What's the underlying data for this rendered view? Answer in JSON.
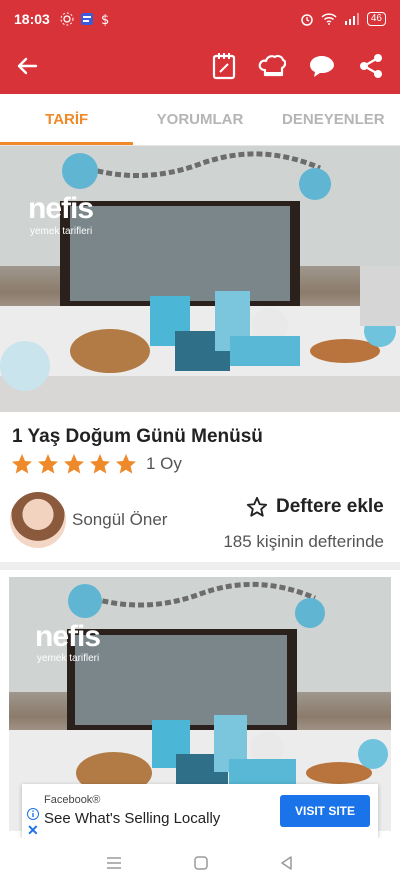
{
  "status_bar": {
    "time": "18:03",
    "battery": "46",
    "icons": [
      "activity-icon",
      "notification-app-icon",
      "dollar-icon",
      "alarm-icon",
      "wifi-icon",
      "signal-icon"
    ]
  },
  "app_bar": {
    "back_icon": "arrow-left-icon",
    "actions": [
      "notebook-icon",
      "chef-hat-icon",
      "comment-icon",
      "share-icon"
    ]
  },
  "tabs": [
    {
      "label": "TARİF",
      "active": true
    },
    {
      "label": "YORUMLAR",
      "active": false
    },
    {
      "label": "DENEYENLER",
      "active": false
    }
  ],
  "hero": {
    "wordmark": "nefis",
    "wordmark_sub": "yemek tarifleri"
  },
  "recipe": {
    "title": "1 Yaş Doğum Günü Menüsü",
    "rating_stars": 5,
    "rating_count": "1 Oy"
  },
  "author": {
    "name": "Songül Öner"
  },
  "save": {
    "label": "Deftere ekle",
    "count_text": "185 kişinin defterinde"
  },
  "second_photo": {
    "wordmark": "nefis",
    "wordmark_sub": "yemek tarifleri"
  },
  "ad": {
    "brand": "Facebook®",
    "headline": "See What's Selling Locally",
    "cta": "VISIT SITE"
  },
  "colors": {
    "primary": "#d9333a",
    "accent": "#ef8a2a",
    "star": "#ef8a2a",
    "ad_button": "#1a73e8"
  }
}
